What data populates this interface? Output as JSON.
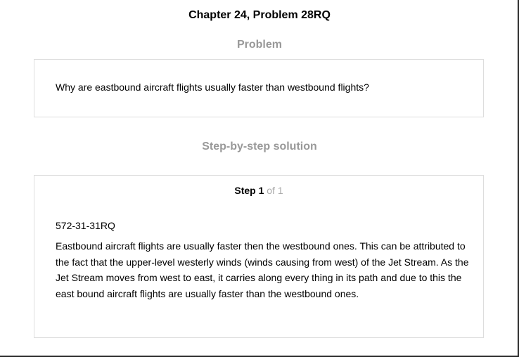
{
  "header": {
    "title": "Chapter 24, Problem 28RQ"
  },
  "problem": {
    "heading": "Problem",
    "question": "Why are eastbound aircraft flights usually faster than westbound flights?"
  },
  "solution": {
    "heading": "Step-by-step solution",
    "step": {
      "label": "Step 1",
      "of_label": "of 1",
      "code": "572-31-31RQ",
      "text": "Eastbound aircraft flights are usually faster then the westbound ones. This can be attributed to the fact that the upper-level westerly winds (winds causing from west) of the Jet Stream. As the Jet Stream moves from west to east, it carries along every thing in its path and due to this the east bound aircraft flights are usually faster than the westbound ones."
    }
  }
}
